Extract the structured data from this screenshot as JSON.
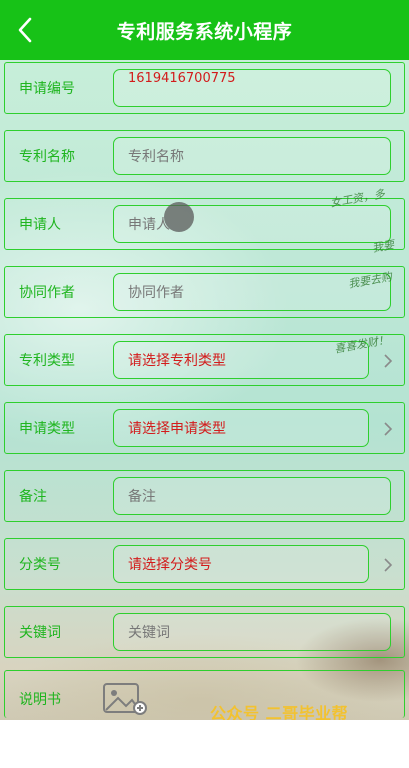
{
  "header": {
    "title": "专利服务系统小程序"
  },
  "form": {
    "rows": [
      {
        "label": "申请编号",
        "value": "1619416700775"
      },
      {
        "label": "专利名称",
        "placeholder": "专利名称"
      },
      {
        "label": "申请人",
        "placeholder": "申请人"
      },
      {
        "label": "协同作者",
        "placeholder": "协同作者"
      },
      {
        "label": "专利类型",
        "select": "请选择专利类型"
      },
      {
        "label": "申请类型",
        "select": "请选择申请类型"
      },
      {
        "label": "备注",
        "placeholder": "备注"
      },
      {
        "label": "分类号",
        "select": "请选择分类号"
      },
      {
        "label": "关键词",
        "placeholder": "关键词"
      },
      {
        "label": "说明书"
      }
    ]
  },
  "decor": {
    "scribbles": [
      "女工资，多",
      "我要",
      "我要去购",
      "喜喜发财！"
    ],
    "watermark": "公众号 二哥毕业帮"
  },
  "icons": {
    "back": "chevron-left-icon",
    "chevron": "chevron-right-icon",
    "upload": "image-upload-icon"
  },
  "colors": {
    "brand": "#17c217",
    "border": "#2ecf2e",
    "label": "#1fb51f",
    "select_text": "#d31b1b",
    "watermark": "#f2c230"
  }
}
